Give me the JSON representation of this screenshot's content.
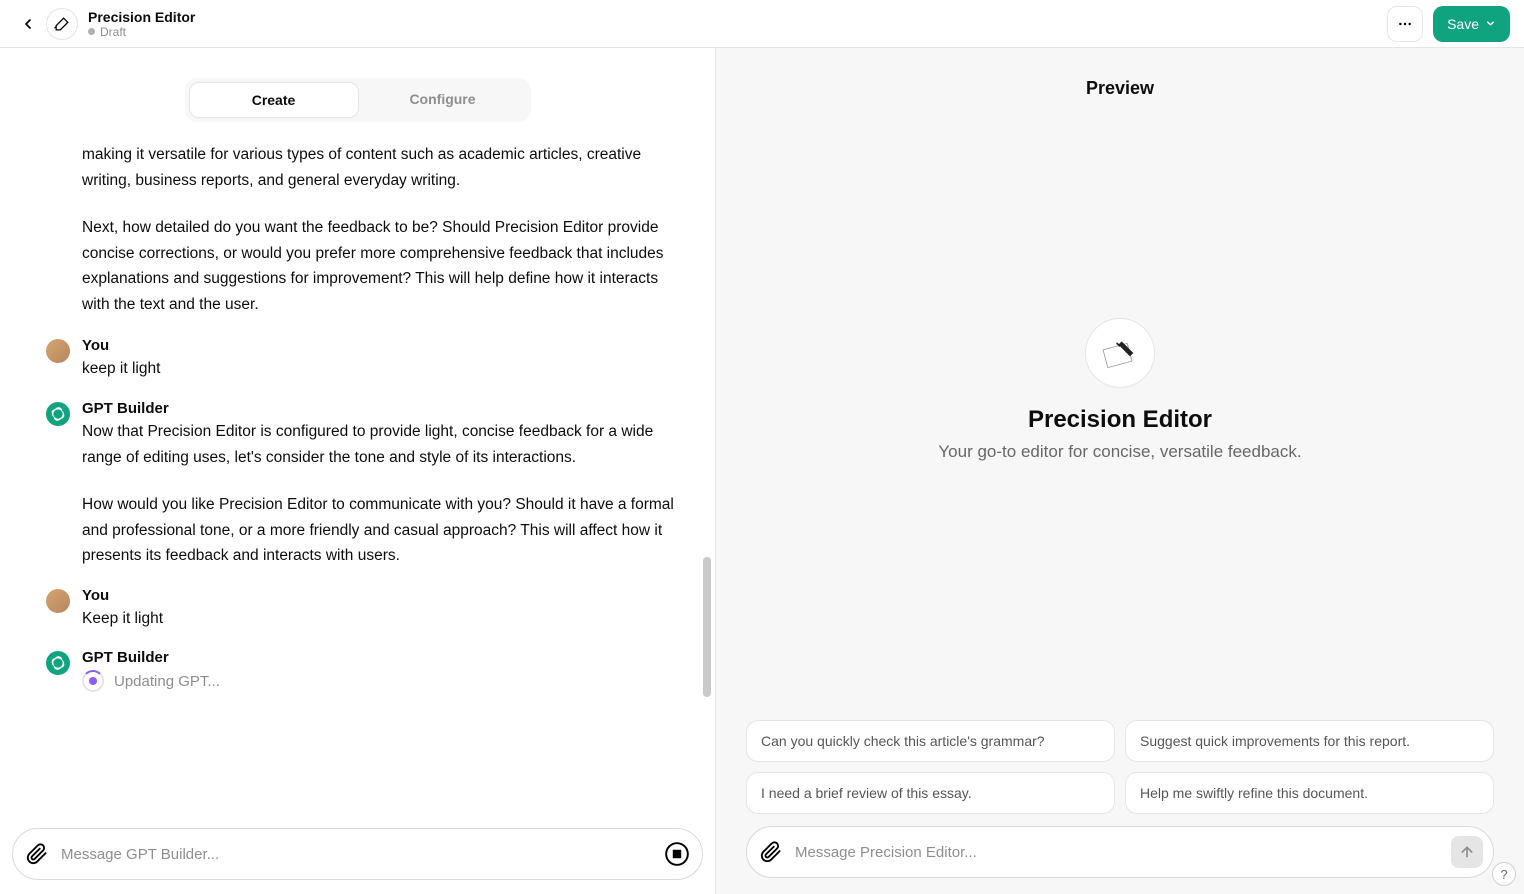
{
  "header": {
    "title": "Precision Editor",
    "status": "Draft",
    "save_label": "Save"
  },
  "tabs": {
    "create": "Create",
    "configure": "Configure"
  },
  "conversation": {
    "first_block_p1": "making it versatile for various types of content such as academic articles, creative writing, business reports, and general everyday writing.",
    "first_block_p2": "Next, how detailed do you want the feedback to be? Should Precision Editor provide concise corrections, or would you prefer more comprehensive feedback that includes explanations and suggestions for improvement? This will help define how it interacts with the text and the user.",
    "msg1_name": "You",
    "msg1_body": "keep it light",
    "msg2_name": "GPT Builder",
    "msg2_p1": "Now that Precision Editor is configured to provide light, concise feedback for a wide range of editing uses, let's consider the tone and style of its interactions.",
    "msg2_p2": "How would you like Precision Editor to communicate with you? Should it have a formal and professional tone, or a more friendly and casual approach? This will affect how it presents its feedback and interacts with users.",
    "msg3_name": "You",
    "msg3_body": "Keep it light",
    "msg4_name": "GPT Builder",
    "updating_text": "Updating GPT...",
    "composer_placeholder": "Message GPT Builder..."
  },
  "preview": {
    "label": "Preview",
    "title": "Precision Editor",
    "subtitle": "Your go-to editor for concise, versatile feedback.",
    "suggestions": [
      "Can you quickly check this article's grammar?",
      "Suggest quick improvements for this report.",
      "I need a brief review of this essay.",
      "Help me swiftly refine this document."
    ],
    "composer_placeholder": "Message Precision Editor..."
  }
}
